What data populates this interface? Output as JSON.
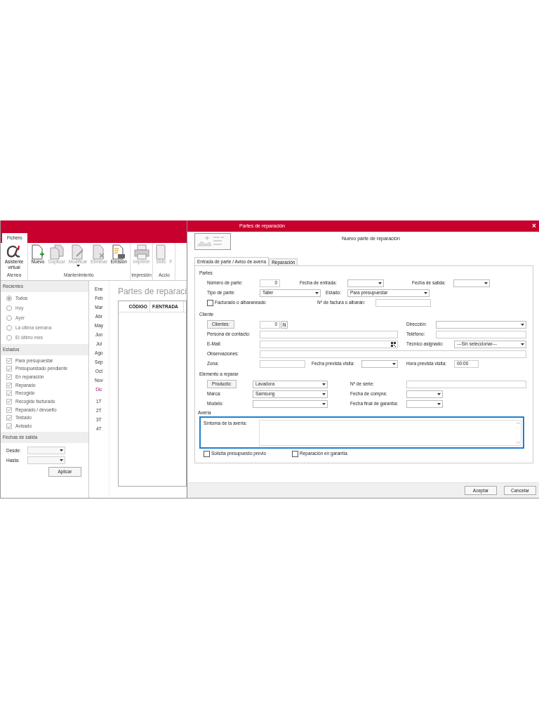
{
  "app": {
    "ribbon": {
      "tabs": [
        {
          "label": "Fichero",
          "selected": true
        }
      ],
      "groups": [
        {
          "label": "Atenea",
          "buttons": [
            {
              "label": "Asistente virtual",
              "kind": "alpha",
              "disabled": false,
              "caret": false
            }
          ]
        },
        {
          "label": "Mantenimiento",
          "buttons": [
            {
              "label": "Nuevo",
              "kind": "new",
              "disabled": false,
              "caret": false
            },
            {
              "label": "Duplicar",
              "kind": "copy",
              "disabled": true,
              "caret": false
            },
            {
              "label": "Modificar",
              "kind": "edit",
              "disabled": true,
              "caret": true
            },
            {
              "label": "Eliminar",
              "kind": "delete",
              "disabled": true,
              "caret": false
            },
            {
              "label": "Emisión",
              "kind": "emit",
              "disabled": false,
              "caret": false
            }
          ]
        },
        {
          "label": "Impresión",
          "buttons": [
            {
              "label": "Imprimir",
              "kind": "print",
              "disabled": true,
              "caret": false
            }
          ]
        },
        {
          "label": "Accio",
          "buttons": [
            {
              "label": "SMS",
              "kind": "sms",
              "disabled": true,
              "caret": false
            },
            {
              "label": "F",
              "kind": "none",
              "disabled": true,
              "caret": false
            }
          ]
        }
      ]
    },
    "filters": {
      "recent_title": "Recientes",
      "recent": [
        {
          "label": "Todos",
          "selected": true
        },
        {
          "label": "Hoy",
          "selected": false
        },
        {
          "label": "Ayer",
          "selected": false
        },
        {
          "label": "La última semana",
          "selected": false
        },
        {
          "label": "El último mes",
          "selected": false
        }
      ],
      "states_title": "Estados",
      "states": [
        {
          "label": "Para presupuestar",
          "checked": true
        },
        {
          "label": "Presupuestado pendiente",
          "checked": true
        },
        {
          "label": "En reparación",
          "checked": true
        },
        {
          "label": "Reparado",
          "checked": true
        },
        {
          "label": "Recogido",
          "checked": true
        },
        {
          "label": "Recogido facturado",
          "checked": true
        },
        {
          "label": "Reparado / devuelto",
          "checked": true
        },
        {
          "label": "Testado",
          "checked": true
        },
        {
          "label": "Avisado",
          "checked": true
        }
      ],
      "dates_title": "Fechas de salida",
      "from_label": "Desde:",
      "to_label": "Hasta:",
      "apply": "Aplicar"
    },
    "periods": [
      {
        "label": "Ene",
        "highlighted": false
      },
      {
        "label": "Feb",
        "highlighted": false
      },
      {
        "label": "Mar",
        "highlighted": false
      },
      {
        "label": "Abr",
        "highlighted": false
      },
      {
        "label": "May",
        "highlighted": false
      },
      {
        "label": "Jun",
        "highlighted": false
      },
      {
        "label": "Jul",
        "highlighted": false
      },
      {
        "label": "Ago",
        "highlighted": false
      },
      {
        "label": "Sep",
        "highlighted": false
      },
      {
        "label": "Oct",
        "highlighted": false
      },
      {
        "label": "Nov",
        "highlighted": false
      },
      {
        "label": "Dic",
        "highlighted": true
      },
      {
        "label": "1T",
        "highlighted": false
      },
      {
        "label": "2T",
        "highlighted": false
      },
      {
        "label": "3T",
        "highlighted": false
      },
      {
        "label": "4T",
        "highlighted": false
      }
    ],
    "list": {
      "title": "Partes de reparaci",
      "columns": [
        "CÓDIGO",
        "F.ENTRADA"
      ]
    }
  },
  "dialog": {
    "title": "Partes de reparación",
    "close": "×",
    "heading": "Nuevo parte de reparación",
    "tabs": [
      {
        "label": "Entrada de parte / Aviso de avería",
        "selected": true
      },
      {
        "label": "Reparación",
        "selected": false
      }
    ],
    "partes": {
      "title": "Partes",
      "numero": {
        "label": "Número de parte:",
        "value": "0"
      },
      "fecha_entrada": {
        "label": "Fecha de entrada:"
      },
      "fecha_salida": {
        "label": "Fecha de salida:"
      },
      "tipo": {
        "label": "Tipo de parte:",
        "value": "Taller"
      },
      "estado": {
        "label": "Estado:",
        "value": "Para presupuestar"
      },
      "facturado": {
        "label": "Facturado o albaraneado",
        "checked": false
      },
      "factura": {
        "label": "Nº de factura o albarán:"
      }
    },
    "cliente": {
      "title": "Cliente",
      "button": "Clientes:",
      "value": "0",
      "new": "N",
      "direccion": {
        "label": "Dirección:"
      },
      "contacto": {
        "label": "Persona de contacto:"
      },
      "telefono": {
        "label": "Teléfono:"
      },
      "email": {
        "label": "E-Mail:"
      },
      "tecnico": {
        "label": "Técnico asignado:",
        "value": "---Sin seleccionar---"
      },
      "observaciones": {
        "label": "Observaciones:"
      },
      "zona": {
        "label": "Zona:"
      },
      "fecha_visita": {
        "label": "Fecha prevista visita:"
      },
      "hora_visita": {
        "label": "Hora prevista visita:",
        "value": "00:00"
      }
    },
    "elemento": {
      "title": "Elemento a reparar",
      "button": "Producto:",
      "producto": "Lavadora",
      "serie": {
        "label": "Nº de serie:"
      },
      "marca": {
        "label": "Marca:",
        "value": "Samsung"
      },
      "compra": {
        "label": "Fecha de compra:"
      },
      "modelo": {
        "label": "Modelo:"
      },
      "garantia_fin": {
        "label": "Fecha final de garantía:"
      }
    },
    "averia": {
      "title": "Avería",
      "label": "Síntoma de la avería:",
      "presupuesto": {
        "label": "Solicita presupuesto previo",
        "checked": false
      },
      "garantia": {
        "label": "Reparación en garantía",
        "checked": false
      }
    },
    "buttons": [
      "Aceptar",
      "Cancelar"
    ]
  }
}
